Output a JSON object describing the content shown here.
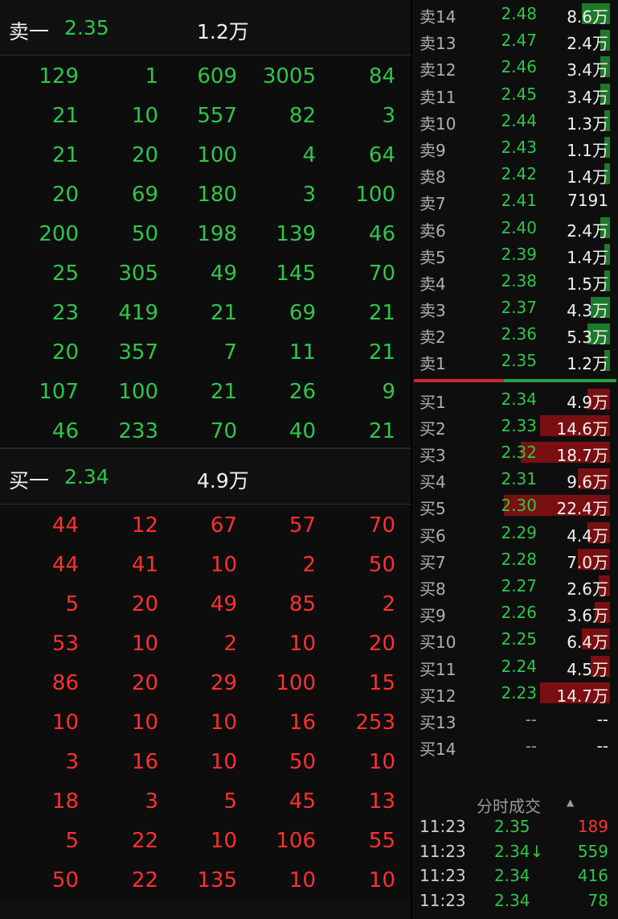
{
  "ask_section": {
    "label": "卖一",
    "price": "2.35",
    "volume": "1.2万",
    "rows": [
      [
        "129",
        "1",
        "609",
        "3005",
        "84"
      ],
      [
        "21",
        "10",
        "557",
        "82",
        "3"
      ],
      [
        "21",
        "20",
        "100",
        "4",
        "64"
      ],
      [
        "20",
        "69",
        "180",
        "3",
        "100"
      ],
      [
        "200",
        "50",
        "198",
        "139",
        "46"
      ],
      [
        "25",
        "305",
        "49",
        "145",
        "70"
      ],
      [
        "23",
        "419",
        "21",
        "69",
        "21"
      ],
      [
        "20",
        "357",
        "7",
        "11",
        "21"
      ],
      [
        "107",
        "100",
        "21",
        "26",
        "9"
      ],
      [
        "46",
        "233",
        "70",
        "40",
        "21"
      ]
    ]
  },
  "bid_section": {
    "label": "买一",
    "price": "2.34",
    "volume": "4.9万",
    "rows": [
      [
        "44",
        "12",
        "67",
        "57",
        "70"
      ],
      [
        "44",
        "41",
        "10",
        "2",
        "50"
      ],
      [
        "5",
        "20",
        "49",
        "85",
        "2"
      ],
      [
        "53",
        "10",
        "2",
        "10",
        "20"
      ],
      [
        "86",
        "20",
        "29",
        "100",
        "15"
      ],
      [
        "10",
        "10",
        "10",
        "16",
        "253"
      ],
      [
        "3",
        "16",
        "10",
        "50",
        "10"
      ],
      [
        "18",
        "3",
        "5",
        "45",
        "13"
      ],
      [
        "5",
        "22",
        "10",
        "106",
        "55"
      ],
      [
        "50",
        "22",
        "135",
        "10",
        "10"
      ]
    ]
  },
  "order_book": {
    "asks": [
      {
        "level": "卖14",
        "price": "2.48",
        "volume": "8.6万",
        "bar": 0.15
      },
      {
        "level": "卖13",
        "price": "2.47",
        "volume": "2.4万",
        "bar": 0.05
      },
      {
        "level": "卖12",
        "price": "2.46",
        "volume": "3.4万",
        "bar": 0.05
      },
      {
        "level": "卖11",
        "price": "2.45",
        "volume": "3.4万",
        "bar": 0.05
      },
      {
        "level": "卖10",
        "price": "2.44",
        "volume": "1.3万",
        "bar": 0.03
      },
      {
        "level": "卖9",
        "price": "2.43",
        "volume": "1.1万",
        "bar": 0.03
      },
      {
        "level": "卖8",
        "price": "2.42",
        "volume": "1.4万",
        "bar": 0.03
      },
      {
        "level": "卖7",
        "price": "2.41",
        "volume": "7191",
        "bar": 0.0
      },
      {
        "level": "卖6",
        "price": "2.40",
        "volume": "2.4万",
        "bar": 0.05
      },
      {
        "level": "卖5",
        "price": "2.39",
        "volume": "1.4万",
        "bar": 0.03
      },
      {
        "level": "卖4",
        "price": "2.38",
        "volume": "1.5万",
        "bar": 0.03
      },
      {
        "level": "卖3",
        "price": "2.37",
        "volume": "4.3万",
        "bar": 0.1
      },
      {
        "level": "卖2",
        "price": "2.36",
        "volume": "5.3万",
        "bar": 0.12
      },
      {
        "level": "卖1",
        "price": "2.35",
        "volume": "1.2万",
        "bar": 0.03
      }
    ],
    "bids": [
      {
        "level": "买1",
        "price": "2.34",
        "volume": "4.9万",
        "bar": 0.12
      },
      {
        "level": "买2",
        "price": "2.33",
        "volume": "14.6万",
        "bar": 0.37
      },
      {
        "level": "买3",
        "price": "2.32",
        "volume": "18.7万",
        "bar": 0.47
      },
      {
        "level": "买4",
        "price": "2.31",
        "volume": "9.6万",
        "bar": 0.17
      },
      {
        "level": "买5",
        "price": "2.30",
        "volume": "22.4万",
        "bar": 0.56
      },
      {
        "level": "买6",
        "price": "2.29",
        "volume": "4.4万",
        "bar": 0.12
      },
      {
        "level": "买7",
        "price": "2.28",
        "volume": "7.0万",
        "bar": 0.17
      },
      {
        "level": "买8",
        "price": "2.27",
        "volume": "2.6万",
        "bar": 0.06
      },
      {
        "level": "买9",
        "price": "2.26",
        "volume": "3.6万",
        "bar": 0.08
      },
      {
        "level": "买10",
        "price": "2.25",
        "volume": "6.4万",
        "bar": 0.15
      },
      {
        "level": "买11",
        "price": "2.24",
        "volume": "4.5万",
        "bar": 0.1
      },
      {
        "level": "买12",
        "price": "2.23",
        "volume": "14.7万",
        "bar": 0.37
      },
      {
        "level": "买13",
        "price": "--",
        "volume": "--",
        "bar": 0
      },
      {
        "level": "买14",
        "price": "--",
        "volume": "--",
        "bar": 0
      }
    ]
  },
  "trades": {
    "title": "分时成交",
    "rows": [
      {
        "time": "11:23",
        "price": "2.35",
        "volume": "189",
        "dir": "red"
      },
      {
        "time": "11:23",
        "price": "2.34↓",
        "volume": "559",
        "dir": "green"
      },
      {
        "time": "11:23",
        "price": "2.34",
        "volume": "416",
        "dir": "green"
      },
      {
        "time": "11:23",
        "price": "2.34",
        "volume": "78",
        "dir": "green"
      }
    ]
  },
  "colors": {
    "up": "#ff3030",
    "down": "#2fc64b",
    "ask_bar": "#1e7a2a",
    "bid_bar": "#7a0f12"
  }
}
